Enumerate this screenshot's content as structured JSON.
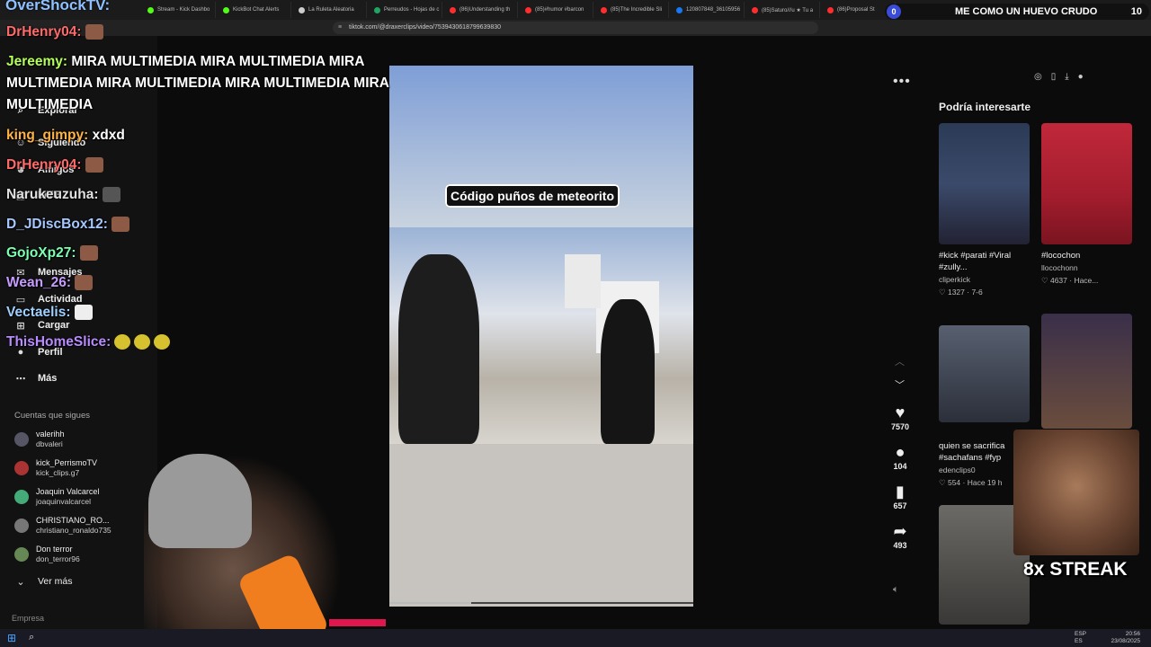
{
  "browser": {
    "tabs": [
      "Stream - Kick Dashbo",
      "KickBot Chat Alerts",
      "La Ruleta Aleatoria",
      "Perreudos - Hojas de c",
      "(86)Understanding th",
      "(85)#humor #barcon",
      "(85)The Incredible Sli",
      "120807848_36105956",
      "(85)Saturo///u ★ Tu a",
      "(86)Proposal St"
    ],
    "url": "tiktok.com/@draxerclips/video/7539430618799639830"
  },
  "sidebar": {
    "items": [
      {
        "icon": "search-icon",
        "label": "Explorar"
      },
      {
        "icon": "user-icon",
        "label": "Siguiendo"
      },
      {
        "icon": "friends-icon",
        "label": "Amigos"
      },
      {
        "icon": "live-icon",
        "label": "LIVE"
      },
      {
        "icon": "message-icon",
        "label": "Mensajes"
      },
      {
        "icon": "bell-icon",
        "label": "Actividad"
      },
      {
        "icon": "plus-icon",
        "label": "Cargar"
      },
      {
        "icon": "profile-icon",
        "label": "Perfil"
      },
      {
        "icon": "more-icon",
        "label": "Más"
      }
    ],
    "following_header": "Cuentas que sigues",
    "following": [
      {
        "name": "valerihh",
        "user": "dbvaleri"
      },
      {
        "name": "kick_PerrismoTV",
        "user": "kick_clips.g7"
      },
      {
        "name": "Joaquin Valcarcel",
        "user": "joaquinvalcarcel"
      },
      {
        "name": "CHRISTIANO_RO...",
        "user": "christiano_ronaldo735"
      },
      {
        "name": "Don terror",
        "user": "don_terror96"
      }
    ],
    "see_more": "Ver más",
    "company": "Empresa"
  },
  "video": {
    "caption": "Código puños de meteorito",
    "progress": 0.27,
    "likes": "7570",
    "comments": "104",
    "saves": "657",
    "shares": "493"
  },
  "right": {
    "title": "Podría interesarte",
    "recs": [
      {
        "title": "#kick #parati #Viral #zully...",
        "author": "cliperkick",
        "meta": "♡ 1327 · 7-6"
      },
      {
        "title": "#locochon",
        "author": "llocochonn",
        "meta": "♡ 4637 · Hace..."
      },
      {
        "title": "quien se sacrifica #sachafans #fyp",
        "author": "edenclips0",
        "meta": "♡ 554 · Hace 19 h"
      }
    ]
  },
  "chat": {
    "channel": "OverShockTV:",
    "messages": [
      {
        "user": "DrHenry04:",
        "text": "",
        "color": "#ff6b6b",
        "emote": true
      },
      {
        "user": "Jereemy:",
        "text": "MIRA MULTIMEDIA MIRA MULTIMEDIA MIRA",
        "color": "#b4ff5a"
      },
      {
        "user": "",
        "text": "MULTIMEDIA MIRA MULTIMEDIA MIRA MULTIMEDIA MIRA",
        "color": "#fff"
      },
      {
        "user": "",
        "text": "MULTIMEDIA",
        "color": "#fff"
      },
      {
        "user": "king_gimpy:",
        "text": "xdxd",
        "color": "#ffb347"
      },
      {
        "user": "DrHenry04:",
        "text": "",
        "color": "#ff6b6b",
        "emote": true
      },
      {
        "user": "Narukeuzuha:",
        "text": "",
        "color": "#e0e0e0",
        "emote": true
      },
      {
        "user": "D_JDiscBox12:",
        "text": "",
        "color": "#a6c8ff",
        "emote": true
      },
      {
        "user": "GojoXp27:",
        "text": "",
        "color": "#7dffb2",
        "emote": true
      },
      {
        "user": "Wean_26:",
        "text": "",
        "color": "#c69cff",
        "emote": true
      },
      {
        "user": "Vectaelis:",
        "text": "",
        "color": "#9fd0ff",
        "emote": true
      },
      {
        "user": "ThisHomeSlice:",
        "text": "",
        "color": "#b88cff",
        "emote3": true
      }
    ]
  },
  "alert": {
    "count": "0",
    "text": "ME COMO UN HUEVO CRUDO",
    "num": "10"
  },
  "streak": "8x STREAK",
  "tray": {
    "lang1": "ESP",
    "lang2": "ES",
    "time": "20:56",
    "date": "23/08/2025"
  }
}
